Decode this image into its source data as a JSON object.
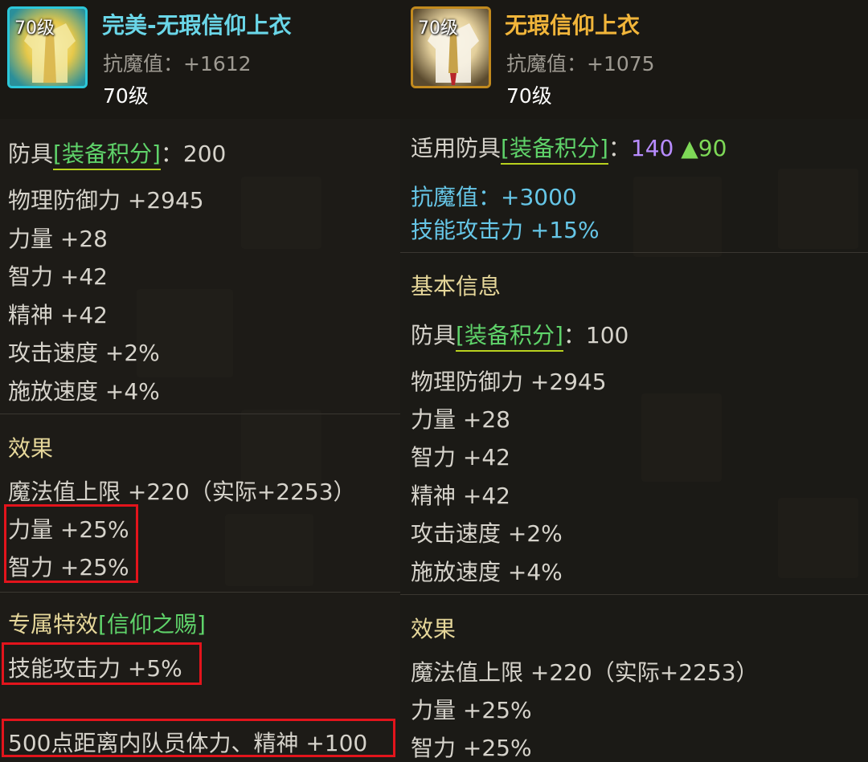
{
  "left": {
    "badge": "70级",
    "title": "完美-无瑕信仰上衣",
    "resist": "抗魔值：+1612",
    "level": "70级",
    "armor_prefix": "防具",
    "armor_tag": "[装备积分]",
    "armor_score": "：200",
    "stats": [
      "物理防御力 +2945",
      "力量 +28",
      "智力 +42",
      "精神 +42",
      "攻击速度 +2%",
      "施放速度 +4%"
    ],
    "effects_header": "效果",
    "effects": [
      "魔法值上限 +220（实际+2253）",
      "力量 +25%",
      "智力 +25%"
    ],
    "exclusive_header": "专属特效",
    "exclusive_tag": "[信仰之赐]",
    "exclusive": [
      "技能攻击力 +5%",
      "500点距离内队员体力、精神 +100"
    ]
  },
  "right": {
    "badge": "70级",
    "title": "无瑕信仰上衣",
    "resist": "抗魔值：+1075",
    "level": "70级",
    "armor_prefix": "适用防具",
    "armor_tag": "[装备积分]",
    "armor_colon": "：",
    "armor_score": "140",
    "armor_up": "▲90",
    "bonus": [
      "抗魔值：+3000",
      "技能攻击力 +15%"
    ],
    "basic_header": "基本信息",
    "basic_armor_prefix": "防具",
    "basic_armor_tag": "[装备积分]",
    "basic_armor_score": "：100",
    "stats": [
      "物理防御力 +2945",
      "力量 +28",
      "智力 +42",
      "精神 +42",
      "攻击速度 +2%",
      "施放速度 +4%"
    ],
    "effects_header": "效果",
    "effects": [
      "魔法值上限 +220（实际+2253）",
      "力量 +25%",
      "智力 +25%"
    ]
  },
  "colors": {
    "left_title": "#6ad6e8",
    "right_title": "#f1b53a",
    "highlight_box": "#e3141c",
    "tag_green": "#5fd36a",
    "section_header": "#e6d79a"
  },
  "icons": [
    "armor-top-icon-perfect",
    "armor-top-icon"
  ]
}
